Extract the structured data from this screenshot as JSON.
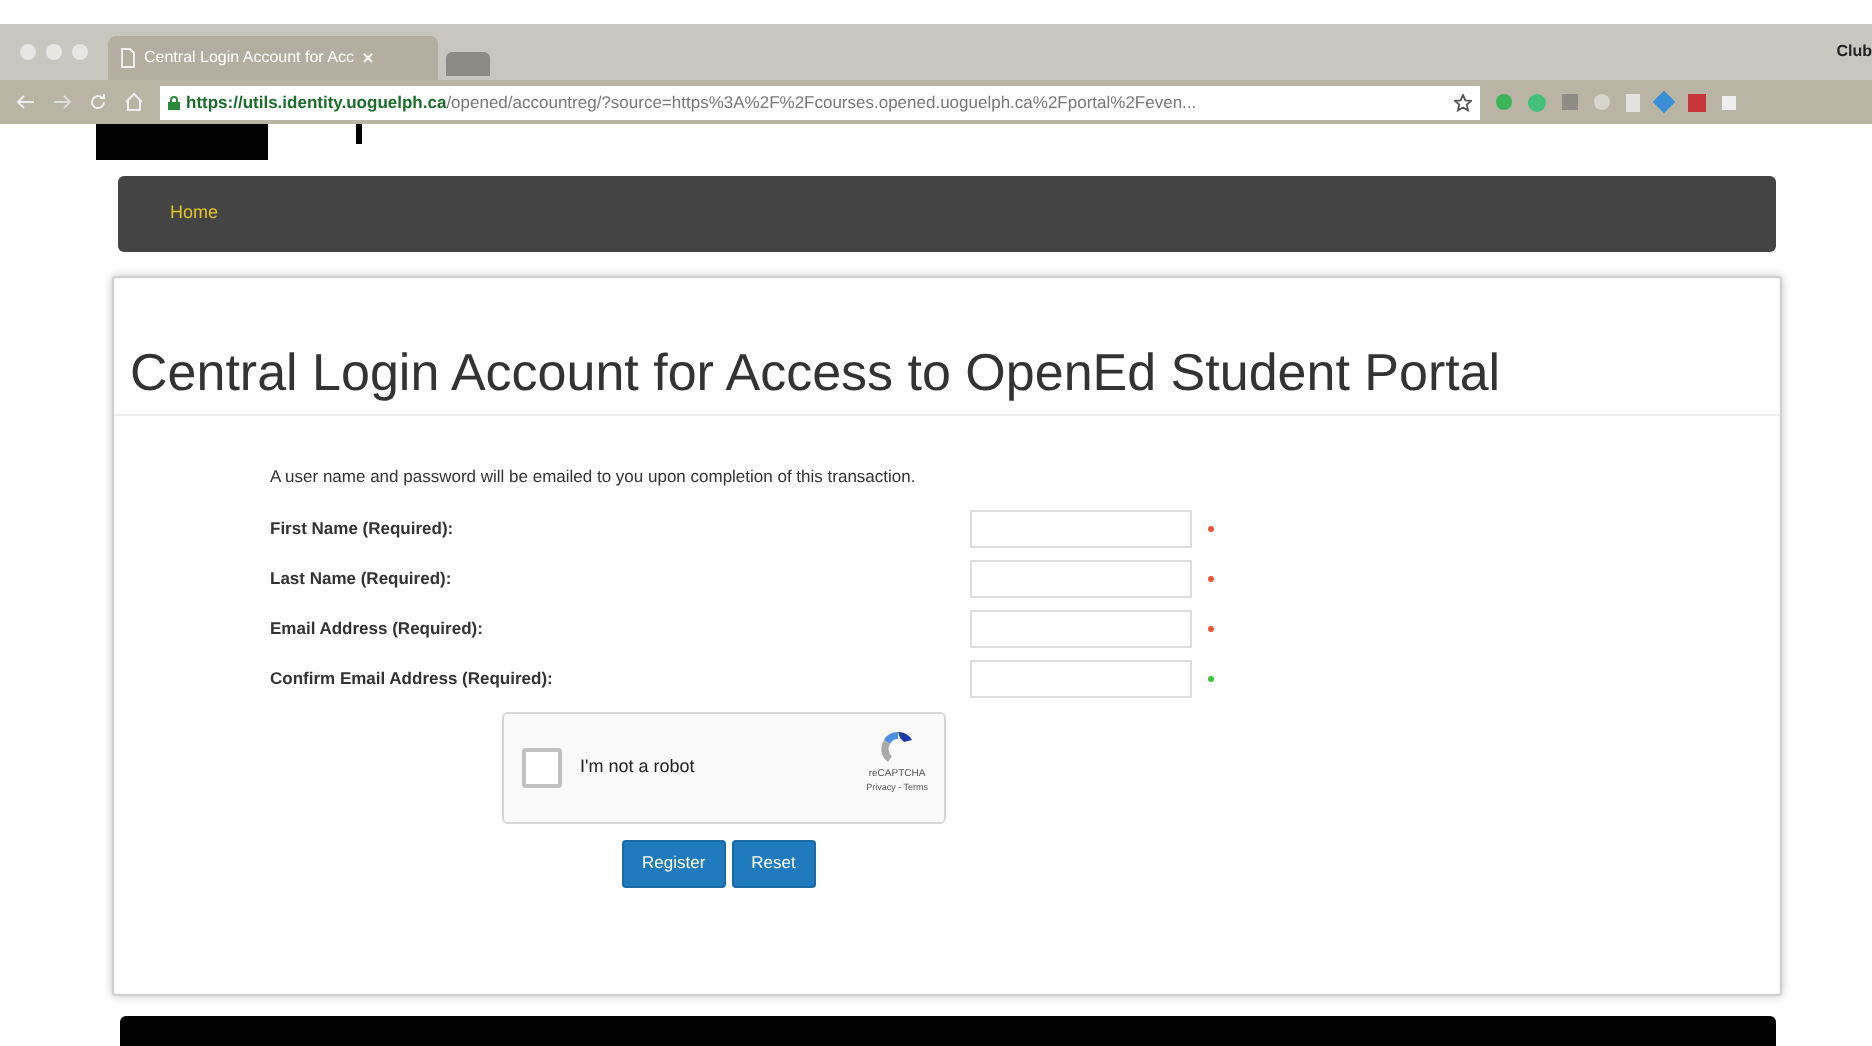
{
  "browser": {
    "tab_title": "Central Login Account for Acc",
    "profile": "Club",
    "url_host": "https://utils.identity.uoguelph.ca",
    "url_path": "/opened/accountreg/?source=https%3A%2F%2Fcourses.opened.uoguelph.ca%2Fportal%2Feven..."
  },
  "nav": {
    "items": [
      {
        "label": "Home"
      }
    ]
  },
  "page": {
    "title": "Central Login Account for Access to OpenEd Student Portal",
    "intro": "A user name and password will be emailed to you upon completion of this transaction.",
    "fields": [
      {
        "label": "First Name (Required):",
        "color": "#e8553a"
      },
      {
        "label": "Last Name (Required):",
        "color": "#e8553a"
      },
      {
        "label": "Email Address (Required):",
        "color": "#e8553a"
      },
      {
        "label": "Confirm Email Address (Required):",
        "color": "#3ec23e"
      }
    ],
    "captcha": {
      "label": "I'm not a robot",
      "checked": false,
      "brand": "reCAPTCHA",
      "links": "Privacy - Terms"
    },
    "buttons": [
      "Register",
      "Reset"
    ]
  }
}
